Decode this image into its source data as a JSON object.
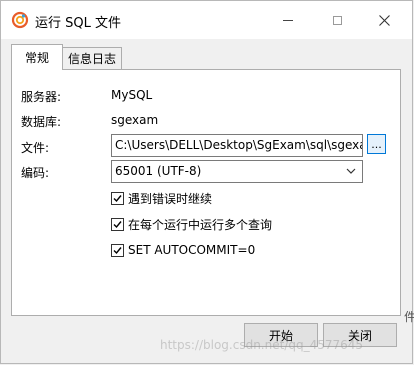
{
  "window": {
    "title": "运行 SQL 文件"
  },
  "tabs": [
    {
      "label": "常规",
      "active": true
    },
    {
      "label": "信息日志",
      "active": false
    }
  ],
  "form": {
    "server_label": "服务器:",
    "server_value": "MySQL",
    "database_label": "数据库:",
    "database_value": "sgexam",
    "file_label": "文件:",
    "file_value": "C:\\Users\\DELL\\Desktop\\SgExam\\sql\\sgexam.sql",
    "browse_label": "...",
    "encoding_label": "编码:",
    "encoding_value": "65001 (UTF-8)"
  },
  "options": [
    {
      "label": "遇到错误时继续",
      "checked": true
    },
    {
      "label": "在每个运行中运行多个查询",
      "checked": true
    },
    {
      "label": "SET AUTOCOMMIT=0",
      "checked": true
    }
  ],
  "buttons": {
    "start": "开始",
    "close": "关闭"
  },
  "watermark": "https://blog.csdn.net/qq_4577645",
  "edge_text": "件",
  "colors": {
    "accent": "#0078d7",
    "panel_bg": "#ffffff",
    "window_bg": "#f0f0f0",
    "button_bg": "#e1e1e1"
  }
}
